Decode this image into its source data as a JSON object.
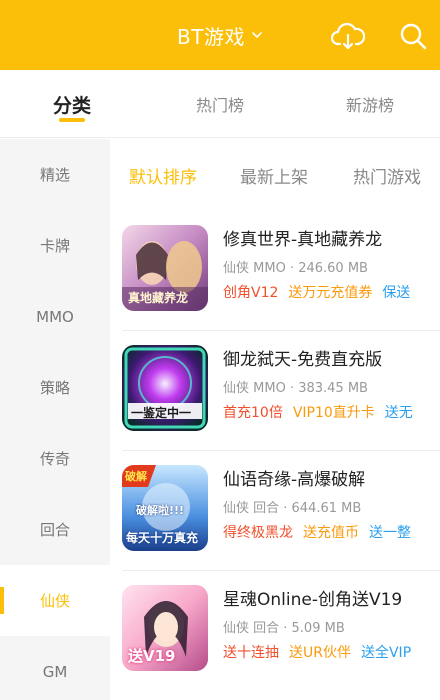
{
  "header": {
    "title": "BT游戏",
    "chevron_icon": "chevron-down-icon",
    "download_icon": "cloud-download-icon",
    "search_icon": "search-icon",
    "background": "#fcbf09"
  },
  "tabs": [
    {
      "label": "分类",
      "active": true
    },
    {
      "label": "热门榜",
      "active": false
    },
    {
      "label": "新游榜",
      "active": false
    }
  ],
  "sidebar": {
    "items": [
      {
        "label": "精选"
      },
      {
        "label": "卡牌"
      },
      {
        "label": "MMO"
      },
      {
        "label": "策略"
      },
      {
        "label": "传奇"
      },
      {
        "label": "回合"
      },
      {
        "label": "仙侠",
        "active": true
      },
      {
        "label": "GM"
      }
    ]
  },
  "sort_options": [
    {
      "label": "默认排序",
      "active": true
    },
    {
      "label": "最新上架"
    },
    {
      "label": "热门游戏"
    }
  ],
  "games": [
    {
      "name": "修真世界-真地藏养龙",
      "meta": "仙侠 MMO · 246.60 MB",
      "tags": [
        {
          "text": "创角V12",
          "color": "red"
        },
        {
          "text": "送万元充值券",
          "color": "orange"
        },
        {
          "text": "保送",
          "color": "blue"
        }
      ],
      "icon_text": "真地藏养龙"
    },
    {
      "name": "御龙弑天-免费直充版",
      "meta": "仙侠 MMO · 383.45 MB",
      "tags": [
        {
          "text": "首充10倍",
          "color": "red"
        },
        {
          "text": "VIP10直升卡",
          "color": "orange"
        },
        {
          "text": "送无",
          "color": "blue"
        }
      ],
      "icon_text": "一鉴定中一"
    },
    {
      "name": "仙语奇缘-高爆破解",
      "meta": "仙侠 回合 · 644.61 MB",
      "tags": [
        {
          "text": "得终极黑龙",
          "color": "red"
        },
        {
          "text": "送充值币",
          "color": "orange"
        },
        {
          "text": "送一整",
          "color": "blue"
        }
      ],
      "icon_text_top": "破解",
      "icon_text_mid": "破解啦!!!",
      "icon_text": "每天十万真充"
    },
    {
      "name": "星魂Online-创角送V19",
      "meta": "仙侠 回合 · 5.09 MB",
      "tags": [
        {
          "text": "送十连抽",
          "color": "red"
        },
        {
          "text": "送UR伙伴",
          "color": "orange"
        },
        {
          "text": "送全VIP",
          "color": "blue"
        }
      ],
      "icon_text": "送V19"
    }
  ]
}
